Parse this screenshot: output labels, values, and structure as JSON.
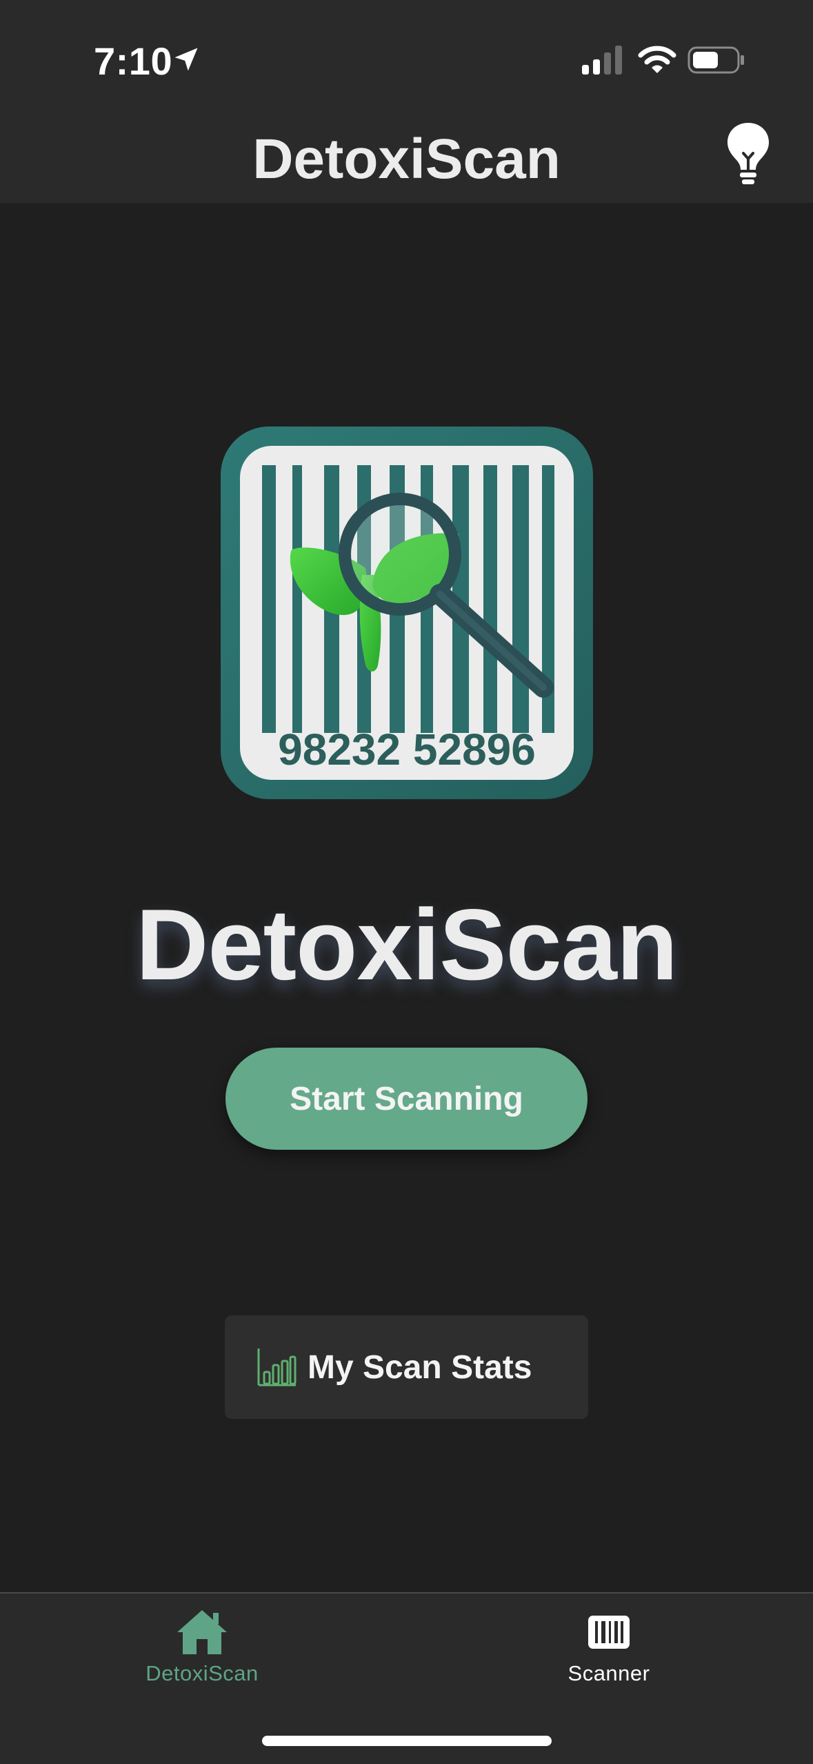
{
  "status_bar": {
    "time": "7:10"
  },
  "header": {
    "title": "DetoxiScan",
    "tips_icon": "lightbulb-icon"
  },
  "logo": {
    "barcode_number": "98232 52896",
    "icon": "barcode-leaf-magnifier-logo"
  },
  "hero": {
    "title": "DetoxiScan"
  },
  "actions": {
    "start_label": "Start Scanning",
    "stats_label": "My Scan Stats",
    "stats_icon": "bar-chart-icon"
  },
  "tabbar": {
    "tabs": [
      {
        "label": "DetoxiScan",
        "icon": "home-icon",
        "active": true
      },
      {
        "label": "Scanner",
        "icon": "barcode-icon",
        "active": false
      }
    ]
  },
  "colors": {
    "accent": "#64a98a",
    "active_tab": "#5fa487",
    "background": "#1f1f1f",
    "bar": "#2a2a2a",
    "logo_teal": "#2e6e6c",
    "leaf_green": "#3cbf3a"
  }
}
